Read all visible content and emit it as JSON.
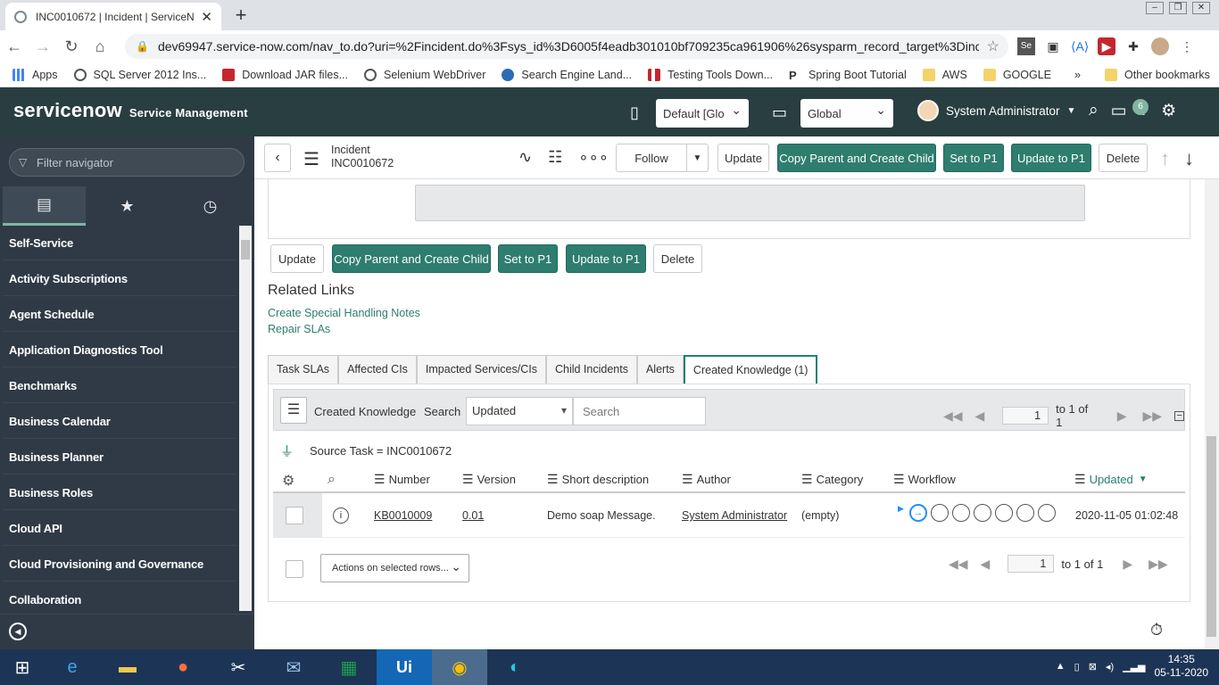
{
  "browser": {
    "tab_title": "INC0010672 | Incident | ServiceN",
    "url": "dev69947.service-now.com/nav_to.do?uri=%2Fincident.do%3Fsys_id%3D6005f4eadb301010bf709235ca961906%26sysparm_record_target%3Dinci...",
    "bookmarks": [
      "Apps",
      "SQL Server 2012 Ins...",
      "Download JAR files...",
      "Selenium WebDriver",
      "Search Engine Land...",
      "Testing Tools Down...",
      "Spring Boot Tutorial",
      "AWS",
      "GOOGLE"
    ],
    "other_bookmarks": "Other bookmarks",
    "more": "»"
  },
  "header": {
    "logo": "servicenow",
    "product": "Service Management",
    "update_set": "Default [Glo",
    "scope": "Global",
    "user": "System Administrator",
    "notif_count": "6"
  },
  "sidebar": {
    "filter_placeholder": "Filter navigator",
    "items": [
      "Self-Service",
      "Activity Subscriptions",
      "Agent Schedule",
      "Application Diagnostics Tool",
      "Benchmarks",
      "Business Calendar",
      "Business Planner",
      "Business Roles",
      "Cloud API",
      "Cloud Provisioning and Governance",
      "Collaboration"
    ]
  },
  "form": {
    "type": "Incident",
    "number": "INC0010672",
    "buttons": {
      "follow": "Follow",
      "update": "Update",
      "copy": "Copy Parent and Create Child",
      "setp1": "Set to P1",
      "updatep1": "Update to P1",
      "delete": "Delete"
    }
  },
  "related": {
    "title": "Related Links",
    "links": [
      "Create Special Handling Notes",
      "Repair SLAs"
    ],
    "tabs": [
      "Task SLAs",
      "Affected CIs",
      "Impacted Services/CIs",
      "Child Incidents",
      "Alerts",
      "Created Knowledge (1)"
    ]
  },
  "list": {
    "title": "Created Knowledge",
    "search_label": "Search",
    "search_field": "Updated",
    "search_placeholder": "Search",
    "page": "1",
    "page_of": "to 1 of 1",
    "condition": "Source Task = INC0010672",
    "columns": [
      "Number",
      "Version",
      "Short description",
      "Author",
      "Category",
      "Workflow",
      "Updated"
    ],
    "row": {
      "number": "KB0010009",
      "version": "0.01",
      "short_description": "Demo soap Message.",
      "author": "System Administrator",
      "category": "(empty)",
      "updated": "2020-11-05 01:02:48"
    },
    "actions": "Actions on selected rows..."
  },
  "taskbar": {
    "time": "14:35",
    "date": "05-11-2020"
  }
}
